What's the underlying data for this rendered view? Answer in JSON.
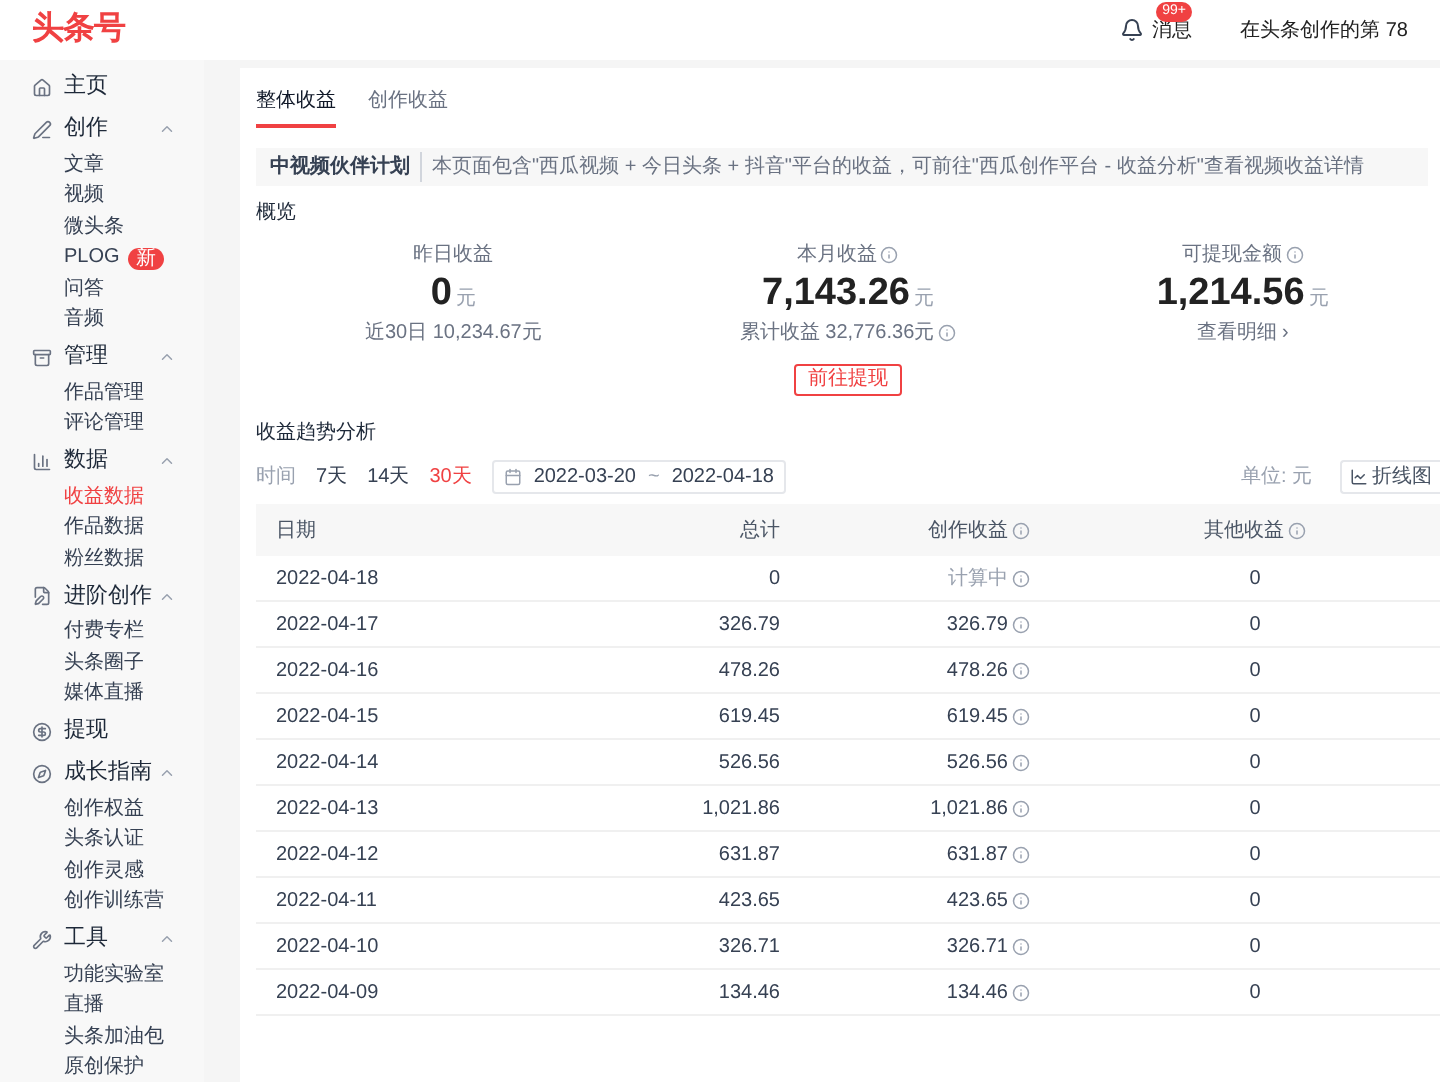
{
  "header": {
    "logo": "头条号",
    "notifications": {
      "label": "消息",
      "badge": "99+"
    },
    "user_text": "在头条创作的第 78"
  },
  "sidebar": {
    "groups": [
      {
        "label": "主页"
      },
      {
        "label": "创作",
        "expanded": true,
        "items": [
          {
            "label": "文章",
            "selected": false
          },
          {
            "label": "视频",
            "selected": false
          },
          {
            "label": "微头条",
            "selected": false
          },
          {
            "label": "PLOG",
            "selected": false,
            "badge": "新"
          },
          {
            "label": "问答",
            "selected": false
          },
          {
            "label": "音频",
            "selected": false
          }
        ]
      },
      {
        "label": "管理",
        "expanded": true,
        "items": [
          {
            "label": "作品管理",
            "selected": false
          },
          {
            "label": "评论管理",
            "selected": false
          }
        ]
      },
      {
        "label": "数据",
        "expanded": true,
        "items": [
          {
            "label": "收益数据",
            "selected": true
          },
          {
            "label": "作品数据",
            "selected": false
          },
          {
            "label": "粉丝数据",
            "selected": false
          }
        ]
      },
      {
        "label": "进阶创作",
        "expanded": true,
        "items": [
          {
            "label": "付费专栏",
            "selected": false
          },
          {
            "label": "头条圈子",
            "selected": false
          },
          {
            "label": "媒体直播",
            "selected": false
          }
        ]
      },
      {
        "label": "提现"
      },
      {
        "label": "成长指南",
        "expanded": true,
        "items": [
          {
            "label": "创作权益",
            "selected": false
          },
          {
            "label": "头条认证",
            "selected": false
          },
          {
            "label": "创作灵感",
            "selected": false
          },
          {
            "label": "创作训练营",
            "selected": false
          }
        ]
      },
      {
        "label": "工具",
        "expanded": true,
        "items": [
          {
            "label": "功能实验室",
            "selected": false
          },
          {
            "label": "直播",
            "selected": false
          },
          {
            "label": "头条加油包",
            "selected": false
          },
          {
            "label": "原创保护",
            "selected": false
          }
        ]
      }
    ]
  },
  "tabs": [
    {
      "label": "整体收益",
      "selected": true
    },
    {
      "label": "创作收益",
      "selected": false
    }
  ],
  "notice": {
    "title": "中视频伙伴计划",
    "text": "本页面包含\"西瓜视频 + 今日头条 + 抖音\"平台的收益，可前往\"西瓜创作平台 - 收益分析\"查看视频收益详情"
  },
  "overview": {
    "title": "概览",
    "stats": [
      {
        "label": "昨日收益",
        "info": false,
        "value": "0",
        "unit": "元",
        "sub": "近30日 10,234.67元",
        "sub_info": false
      },
      {
        "label": "本月收益",
        "info": true,
        "value": "7,143.26",
        "unit": "元",
        "sub": "累计收益 32,776.36元",
        "sub_info": true
      },
      {
        "label": "可提现金额",
        "info": true,
        "value": "1,214.56",
        "unit": "元",
        "sub": "查看明细 ›",
        "sub_info": false
      }
    ],
    "button": "前往提现"
  },
  "trend": {
    "title": "收益趋势分析",
    "range_label": "时间",
    "ranges": [
      {
        "label": "7天",
        "selected": false
      },
      {
        "label": "14天",
        "selected": false
      },
      {
        "label": "30天",
        "selected": true
      }
    ],
    "date_start": "2022-03-20",
    "date_sep": "~",
    "date_end": "2022-04-18",
    "unit": "单位: 元",
    "chart_button": "折线图"
  },
  "table": {
    "columns": [
      {
        "label": "日期",
        "info": false
      },
      {
        "label": "总计",
        "info": false
      },
      {
        "label": "创作收益",
        "info": true
      },
      {
        "label": "其他收益",
        "info": true
      }
    ],
    "rows": [
      {
        "date": "2022-04-18",
        "total": "0",
        "creation": "计算中",
        "pending": true,
        "other": "0"
      },
      {
        "date": "2022-04-17",
        "total": "326.79",
        "creation": "326.79",
        "pending": false,
        "other": "0"
      },
      {
        "date": "2022-04-16",
        "total": "478.26",
        "creation": "478.26",
        "pending": false,
        "other": "0"
      },
      {
        "date": "2022-04-15",
        "total": "619.45",
        "creation": "619.45",
        "pending": false,
        "other": "0"
      },
      {
        "date": "2022-04-14",
        "total": "526.56",
        "creation": "526.56",
        "pending": false,
        "other": "0"
      },
      {
        "date": "2022-04-13",
        "total": "1,021.86",
        "creation": "1,021.86",
        "pending": false,
        "other": "0"
      },
      {
        "date": "2022-04-12",
        "total": "631.87",
        "creation": "631.87",
        "pending": false,
        "other": "0"
      },
      {
        "date": "2022-04-11",
        "total": "423.65",
        "creation": "423.65",
        "pending": false,
        "other": "0"
      },
      {
        "date": "2022-04-10",
        "total": "326.71",
        "creation": "326.71",
        "pending": false,
        "other": "0"
      },
      {
        "date": "2022-04-09",
        "total": "134.46",
        "creation": "134.46",
        "pending": false,
        "other": "0"
      }
    ]
  }
}
